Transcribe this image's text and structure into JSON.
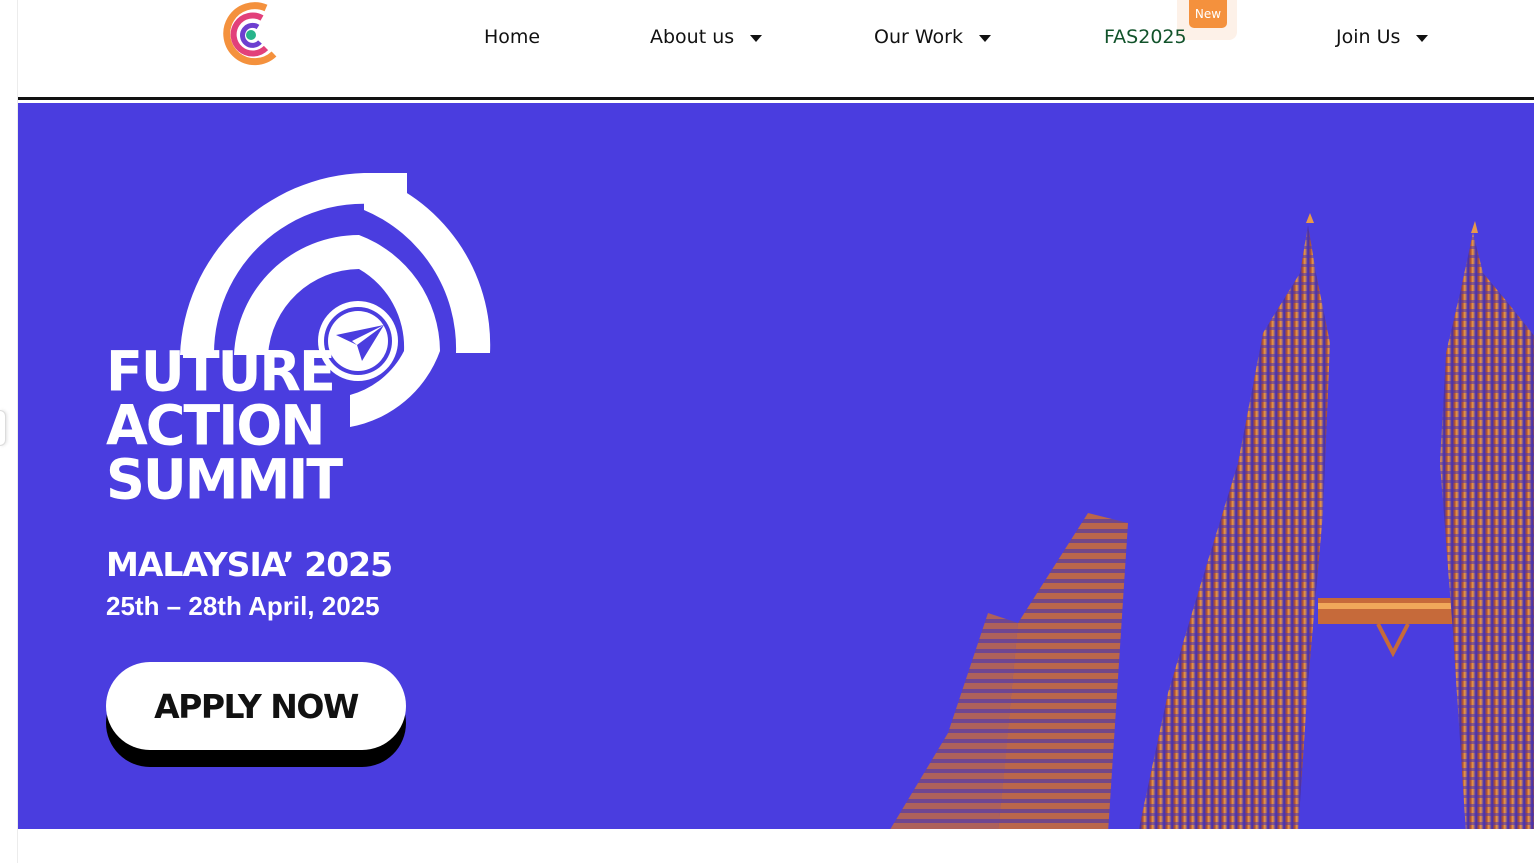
{
  "nav": {
    "items": [
      {
        "label": "Home"
      },
      {
        "label": "About us"
      },
      {
        "label": "Our Work"
      },
      {
        "label": "FAS2025"
      },
      {
        "label": "Join Us"
      }
    ],
    "badge": "New"
  },
  "hero": {
    "title_lines": [
      "FUTURE",
      "ACTION",
      "SUMMIT"
    ],
    "place": "MALAYSIA’ 2025",
    "dates": "25th – 28th April, 2025",
    "cta": "APPLY NOW",
    "background_color": "#4a3ddf"
  },
  "colors": {
    "accent_green": "#12532b",
    "badge_orange": "#f4913d"
  }
}
